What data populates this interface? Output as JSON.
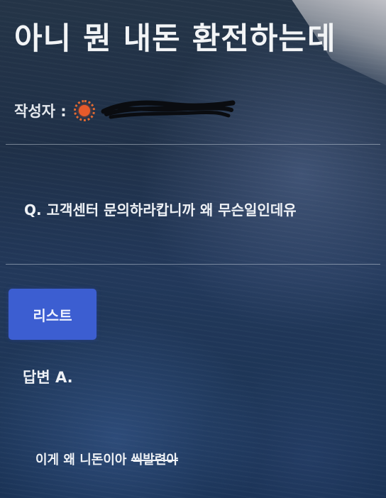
{
  "post": {
    "title": "아니 뭔 내돈 환전하는데",
    "author_label": "작성자 :",
    "question": "Q. 고객센터 문의하라캅니까 왜 무슨일인데유"
  },
  "actions": {
    "list_button": "리스트"
  },
  "answer": {
    "label": "답변 A.",
    "body_prefix": "이게 왜 니돈이아 ",
    "body_strike": "씩발련아"
  },
  "icons": {
    "author_badge": "level-badge-icon"
  },
  "colors": {
    "button": "#3c5ed1",
    "badge": "#e65a2b"
  }
}
